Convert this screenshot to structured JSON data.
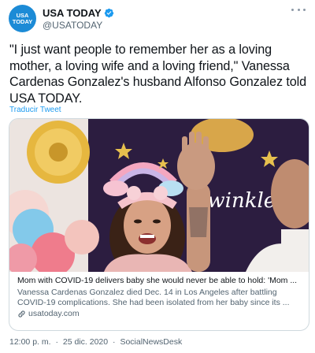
{
  "account": {
    "avatar_line1": "USA",
    "avatar_line2": "TODAY",
    "display_name": "USA TODAY",
    "handle": "@USATODAY"
  },
  "tweet": {
    "text": "\"I just want people to remember her as a loving mother, a loving wife and a loving friend,\" Vanessa Cardenas Gonzalez's husband Alfonso Gonzalez told USA TODAY.",
    "translate_label": "Traducir Tweet"
  },
  "card": {
    "title": "Mom with COVID-19 delivers baby she would never be able to hold: 'Mom ...",
    "description": "Vanessa Cardenas Gonzalez died Dec. 14 in Los Angeles after battling COVID-19 complications. She had been isolated from her baby since its ...",
    "domain": "usatoday.com",
    "image_sign_text": "Twinkle twinkle"
  },
  "meta": {
    "time": "12:00 p. m.",
    "separator": "·",
    "date": "25 dic. 2020",
    "source": "SocialNewsDesk"
  },
  "colors": {
    "brand_blue": "#1c8bd6",
    "link_blue": "#1d9bf0",
    "text_primary": "#0f1419",
    "text_secondary": "#536471"
  },
  "icons": {
    "verified": "verified-badge-icon",
    "more": "more-options-icon",
    "link": "link-icon"
  }
}
